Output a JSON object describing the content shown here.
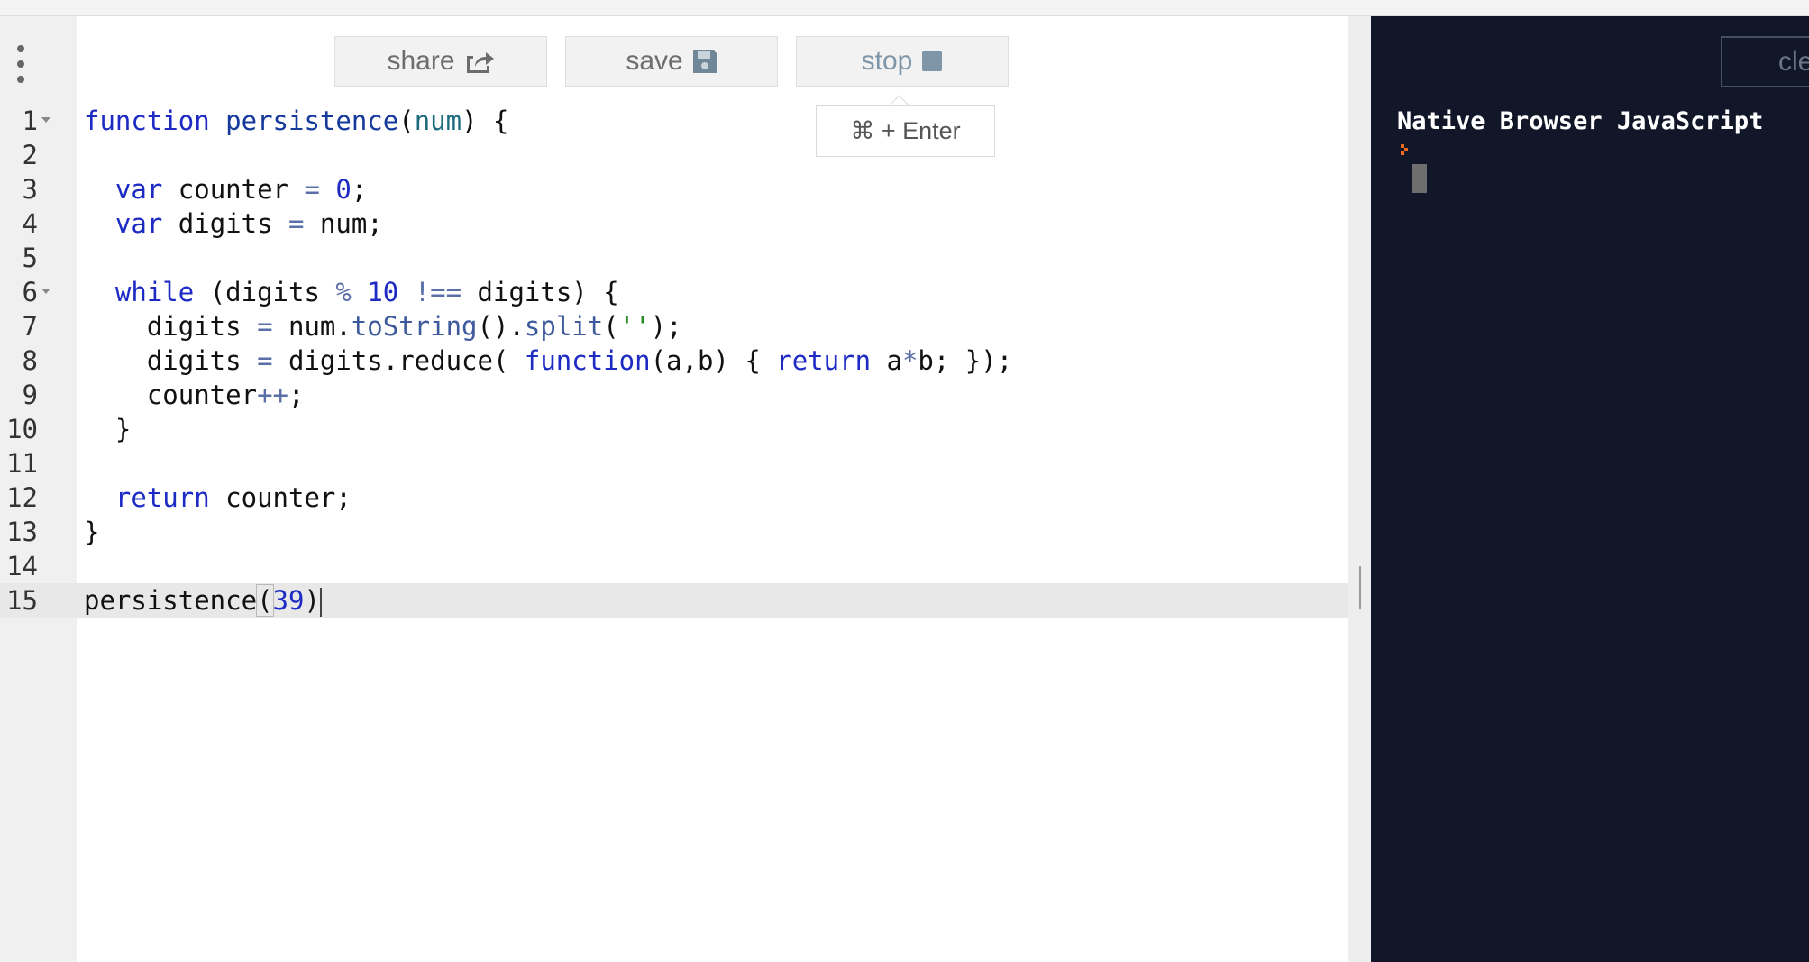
{
  "toolbar": {
    "share_label": "share",
    "save_label": "save",
    "stop_label": "stop",
    "run_shortcut_tooltip": "⌘ + Enter",
    "share_icon": "share-export-icon",
    "save_icon": "floppy-disk-icon",
    "stop_icon": "stop-square-icon"
  },
  "editor": {
    "language": "javascript",
    "active_line": 15,
    "lines": [
      {
        "number": "1",
        "foldable": true,
        "text": "function persistence(num) {"
      },
      {
        "number": "2",
        "foldable": false,
        "text": ""
      },
      {
        "number": "3",
        "foldable": false,
        "text": "  var counter = 0;"
      },
      {
        "number": "4",
        "foldable": false,
        "text": "  var digits = num;"
      },
      {
        "number": "5",
        "foldable": false,
        "text": ""
      },
      {
        "number": "6",
        "foldable": true,
        "text": "  while (digits % 10 !== digits) {"
      },
      {
        "number": "7",
        "foldable": false,
        "text": "    digits = num.toString().split('');"
      },
      {
        "number": "8",
        "foldable": false,
        "text": "    digits = digits.reduce( function(a,b) { return a*b; });"
      },
      {
        "number": "9",
        "foldable": false,
        "text": "    counter++;"
      },
      {
        "number": "10",
        "foldable": false,
        "text": "  }"
      },
      {
        "number": "11",
        "foldable": false,
        "text": ""
      },
      {
        "number": "12",
        "foldable": false,
        "text": "  return counter;"
      },
      {
        "number": "13",
        "foldable": false,
        "text": "}"
      },
      {
        "number": "14",
        "foldable": false,
        "text": ""
      },
      {
        "number": "15",
        "foldable": false,
        "text": "persistence(39)"
      }
    ]
  },
  "console": {
    "clear_label": "clear",
    "title": "Native Browser JavaScript",
    "prompt_icon": "prompt-chevron-icon"
  },
  "colors": {
    "console_background": "#111629",
    "keyword": "#1d2bc4",
    "prompt": "#f06a1b"
  }
}
